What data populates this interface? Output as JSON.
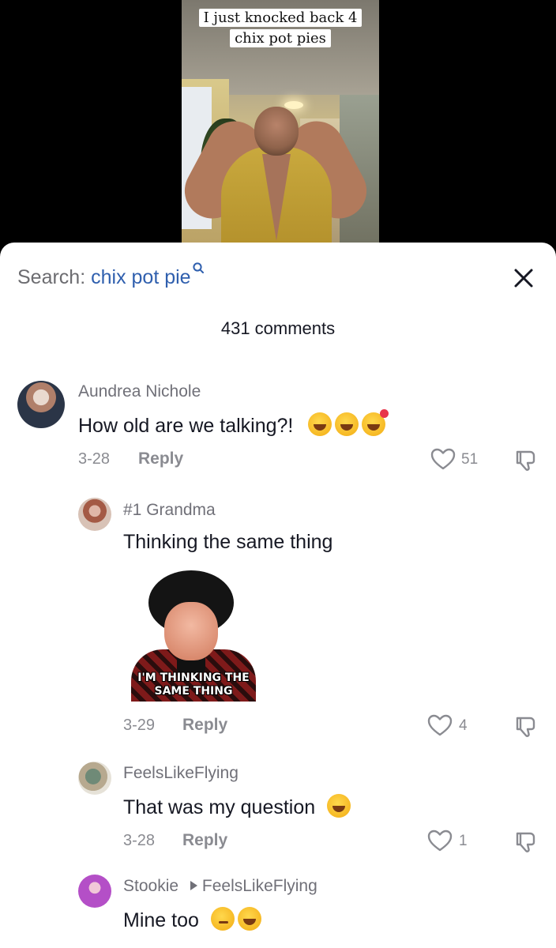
{
  "video": {
    "caption": "I just knocked back 4 chix pot pies"
  },
  "sheet": {
    "search_prefix": "Search: ",
    "search_query": "chix pot pie",
    "comment_count": "431 comments"
  },
  "comments": [
    {
      "username": "Aundrea Nichole",
      "text": "How old are we talking?!",
      "emojis": [
        "grinning",
        "tears-of-joy",
        "smiling-hearts"
      ],
      "date": "3-28",
      "reply_label": "Reply",
      "likes": "51"
    },
    {
      "username": "#1 Grandma",
      "text": "Thinking the same thing",
      "sticker_text": "I'M THINKING THE SAME THING",
      "date": "3-29",
      "reply_label": "Reply",
      "likes": "4"
    },
    {
      "username": "FeelsLikeFlying",
      "text": "That was my question",
      "emojis": [
        "tears-of-joy"
      ],
      "date": "3-28",
      "reply_label": "Reply",
      "likes": "1"
    },
    {
      "username": "Stookie",
      "reply_to": "FeelsLikeFlying",
      "text": "Mine too",
      "emojis": [
        "smirk",
        "tears-of-joy"
      ]
    }
  ],
  "colors": {
    "link_blue": "#2f5fae",
    "meta_gray": "#8a8b91",
    "text_dark": "#161823"
  },
  "icons": [
    "search-icon",
    "close-icon",
    "heart-outline-icon",
    "dislike-icon",
    "reply-arrow-icon"
  ]
}
